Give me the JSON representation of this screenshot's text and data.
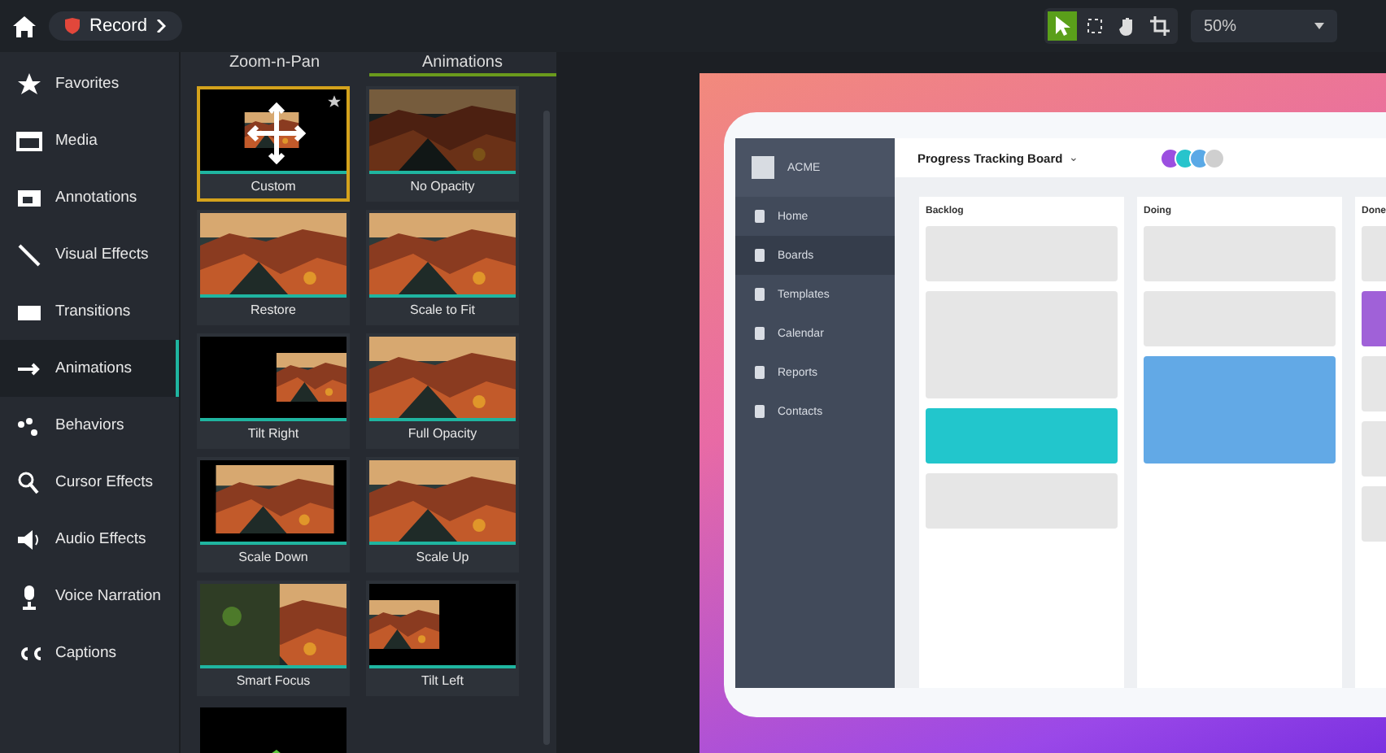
{
  "breadcrumb": {
    "label": "Record"
  },
  "tools": [
    {
      "kind": "pointer",
      "selected": true
    },
    {
      "kind": "crop-frame",
      "selected": false
    },
    {
      "kind": "hand",
      "selected": false
    },
    {
      "kind": "crop",
      "selected": false
    }
  ],
  "zoom": {
    "value": "50%"
  },
  "sidebar": {
    "items": [
      {
        "label": "Favorites",
        "selected": false
      },
      {
        "label": "Media",
        "selected": false
      },
      {
        "label": "Annotations",
        "selected": false
      },
      {
        "label": "Visual Effects",
        "selected": false
      },
      {
        "label": "Transitions",
        "selected": false
      },
      {
        "label": "Animations",
        "selected": true
      },
      {
        "label": "Behaviors",
        "selected": false
      },
      {
        "label": "Cursor Effects",
        "selected": false
      },
      {
        "label": "Audio Effects",
        "selected": false
      },
      {
        "label": "Voice Narration",
        "selected": false
      },
      {
        "label": "Captions",
        "selected": false
      }
    ]
  },
  "tabs": [
    {
      "label": "Zoom-n-Pan",
      "selected": false
    },
    {
      "label": "Animations",
      "selected": true
    }
  ],
  "tiles": [
    {
      "label": "Custom",
      "kind": "custom",
      "selected": true
    },
    {
      "label": "No Opacity",
      "kind": "dark",
      "selected": false
    },
    {
      "label": "Restore",
      "kind": "full",
      "selected": false
    },
    {
      "label": "Scale to Fit",
      "kind": "full",
      "selected": false
    },
    {
      "label": "Tilt Right",
      "kind": "right",
      "selected": false
    },
    {
      "label": "Full Opacity",
      "kind": "full",
      "selected": false
    },
    {
      "label": "Scale Down",
      "kind": "center",
      "selected": false
    },
    {
      "label": "Scale Up",
      "kind": "zoomed",
      "selected": false
    },
    {
      "label": "Smart Focus",
      "kind": "focus",
      "selected": false
    },
    {
      "label": "Tilt Left",
      "kind": "left",
      "selected": false
    },
    {
      "kind": "partial"
    }
  ],
  "preview": {
    "brand": "ACME",
    "board_title": "Progress Tracking Board",
    "caret": "⌄",
    "avatars": [
      {
        "color": "#9b4fe0"
      },
      {
        "color": "#27c4cc"
      },
      {
        "color": "#5aa9e6"
      },
      {
        "color": "#cfcfcf"
      }
    ],
    "nav": [
      {
        "label": "Home",
        "selected": false
      },
      {
        "label": "Boards",
        "selected": true
      },
      {
        "label": "Templates",
        "selected": false
      },
      {
        "label": "Calendar",
        "selected": false
      },
      {
        "label": "Reports",
        "selected": false
      },
      {
        "label": "Contacts",
        "selected": false
      }
    ],
    "lanes": [
      {
        "title": "Backlog",
        "cards": [
          {
            "color": "#e6e6e6",
            "kind": "short"
          },
          {
            "color": "#e6e6e6",
            "kind": "tall"
          },
          {
            "color": "#22c6cc",
            "kind": "short"
          },
          {
            "color": "#e6e6e6",
            "kind": "short"
          }
        ]
      },
      {
        "title": "Doing",
        "cards": [
          {
            "color": "#e6e6e6",
            "kind": "short"
          },
          {
            "color": "#e6e6e6",
            "kind": "short"
          },
          {
            "color": "#62a9e6",
            "kind": "tall"
          }
        ]
      },
      {
        "title": "Done",
        "cards": [
          {
            "color": "#e6e6e6",
            "kind": "short"
          },
          {
            "color": "#a061d8",
            "kind": "short"
          },
          {
            "color": "#e6e6e6",
            "kind": "short"
          },
          {
            "color": "#e6e6e6",
            "kind": "short"
          },
          {
            "color": "#e6e6e6",
            "kind": "short"
          }
        ]
      }
    ]
  }
}
